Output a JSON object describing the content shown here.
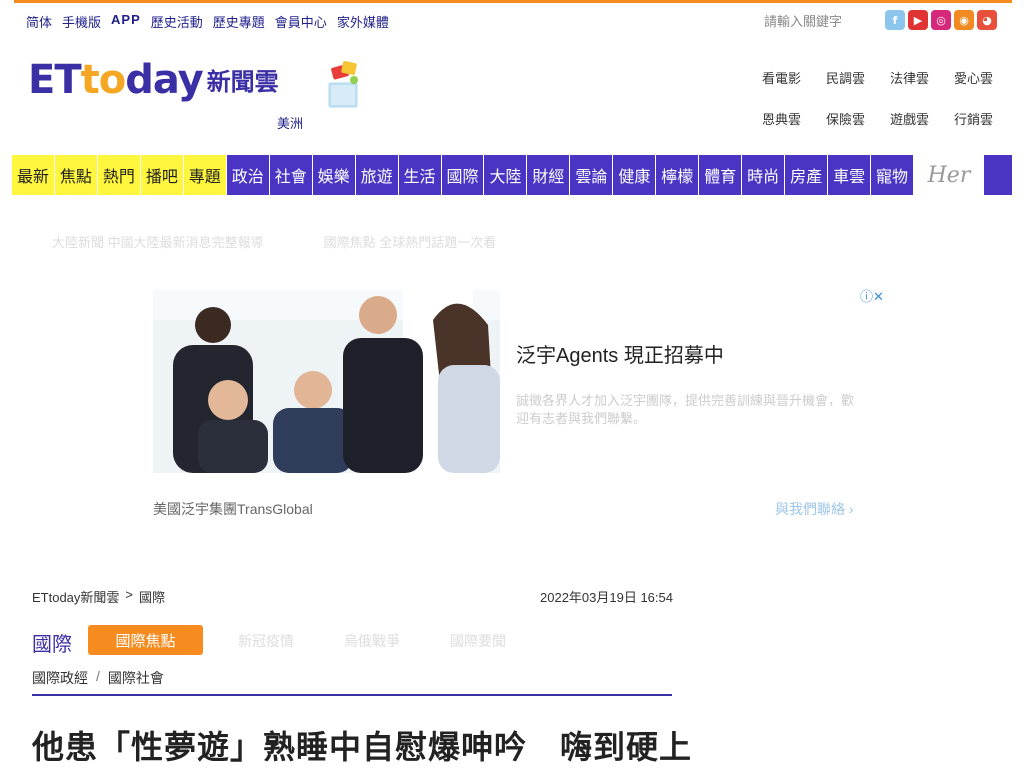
{
  "top_links": [
    "简体",
    "手機版",
    "APP",
    "歷史活動",
    "歷史專題",
    "會員中心",
    "家外媒體"
  ],
  "search": {
    "placeholder": "請輸入關鍵字"
  },
  "social_icons": [
    "facebook-icon",
    "youtube-icon",
    "instagram-icon",
    "rss-icon",
    "weibo-icon"
  ],
  "logo": {
    "et": "ET",
    "today_a": "to",
    "today_b": "day",
    "cloud": "新聞雲",
    "region": "美洲"
  },
  "subsites": [
    "看電影",
    "民調雲",
    "法律雲",
    "愛心雲",
    "恩典雲",
    "保險雲",
    "遊戲雲",
    "行銷雲"
  ],
  "nav": {
    "yellow": [
      "最新",
      "焦點",
      "熱門",
      "播吧",
      "專題"
    ],
    "purple": [
      "政治",
      "社會",
      "娛樂",
      "旅遊",
      "生活",
      "國際",
      "大陸",
      "財經",
      "雲論",
      "健康",
      "檸檬",
      "體育",
      "時尚",
      "房產",
      "車雲",
      "寵物"
    ],
    "her": "Her"
  },
  "ticker": [
    "大陸新聞 中國大陸最新消息完整報導",
    "國際焦點 全球熱門話題一次看"
  ],
  "ad": {
    "title": "泛宇Agents 現正招募中",
    "desc": "誠徵各界人才加入泛宇團隊，提供完善訓練與晉升機會，歡迎有志者與我們聯繫。",
    "advertiser": "美國泛宇集團TransGlobal",
    "cta": "與我們聯絡",
    "choice": "ⓘ✕"
  },
  "breadcrumb": {
    "home": "ETtoday新聞雲",
    "sep": ">",
    "section": "國際"
  },
  "date": "2022年03月19日 16:54",
  "section_title": "國際",
  "focus_button": "國際焦點",
  "subtabs": [
    "新冠疫情",
    "烏俄戰爭",
    "國際要聞"
  ],
  "categories": [
    "國際政經",
    "國際社會"
  ],
  "category_sep": "/",
  "headline": "他患「性夢遊」熟睡中自慰爆呻吟　嗨到硬上"
}
